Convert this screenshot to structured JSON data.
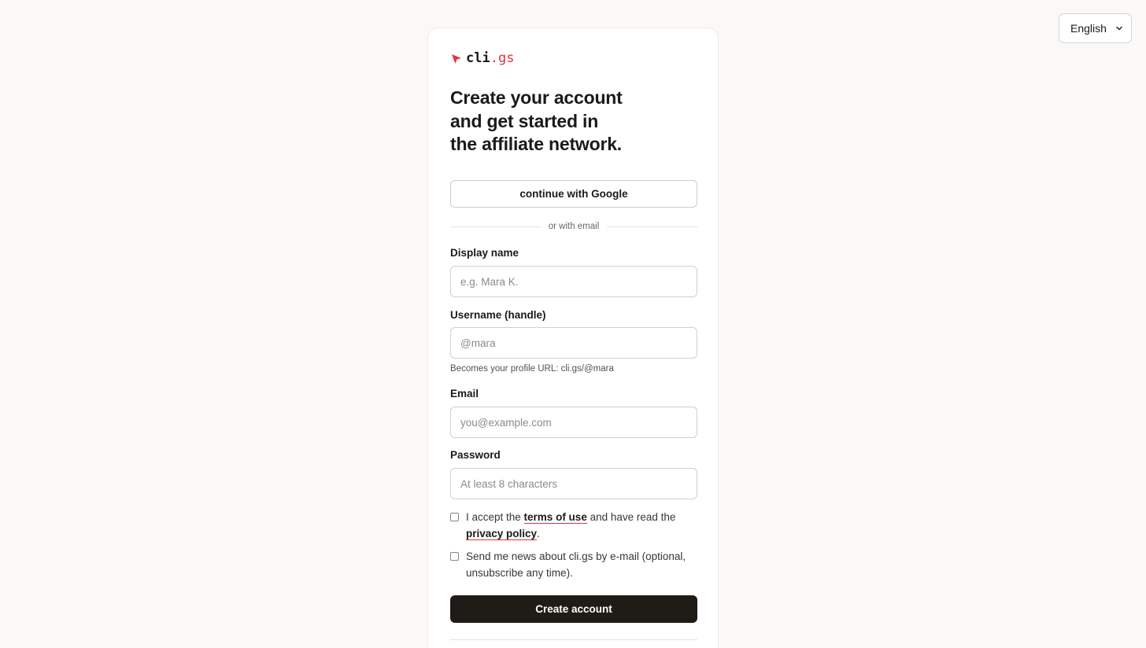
{
  "language": {
    "selected": "English"
  },
  "logo": {
    "main": "cli",
    "accent": ".gs"
  },
  "headline": {
    "line1": "Create your account",
    "line2": "and get started in",
    "line3": "the affiliate network."
  },
  "google_button": "continue with Google",
  "divider_text": "or with email",
  "fields": {
    "display_name": {
      "label": "Display name",
      "placeholder": "e.g. Mara K.",
      "value": ""
    },
    "username": {
      "label": "Username (handle)",
      "placeholder": "@mara",
      "value": "",
      "hint": "Becomes your profile URL: cli.gs/@mara"
    },
    "email": {
      "label": "Email",
      "placeholder": "you@example.com",
      "value": ""
    },
    "password": {
      "label": "Password",
      "placeholder": "At least 8 characters",
      "value": ""
    }
  },
  "terms": {
    "prefix": "I accept the ",
    "terms_link": "terms of use",
    "middle": " and have read the ",
    "privacy_link": "privacy policy",
    "suffix": ".",
    "checked": false
  },
  "newsletter": {
    "text": "Send me news about cli.gs by e‑mail (optional, unsubscribe any time).",
    "checked": false
  },
  "submit_button": "Create account",
  "colors": {
    "accent": "#e0353f",
    "primary_button": "#1f1b16",
    "background": "#faf9f7"
  }
}
